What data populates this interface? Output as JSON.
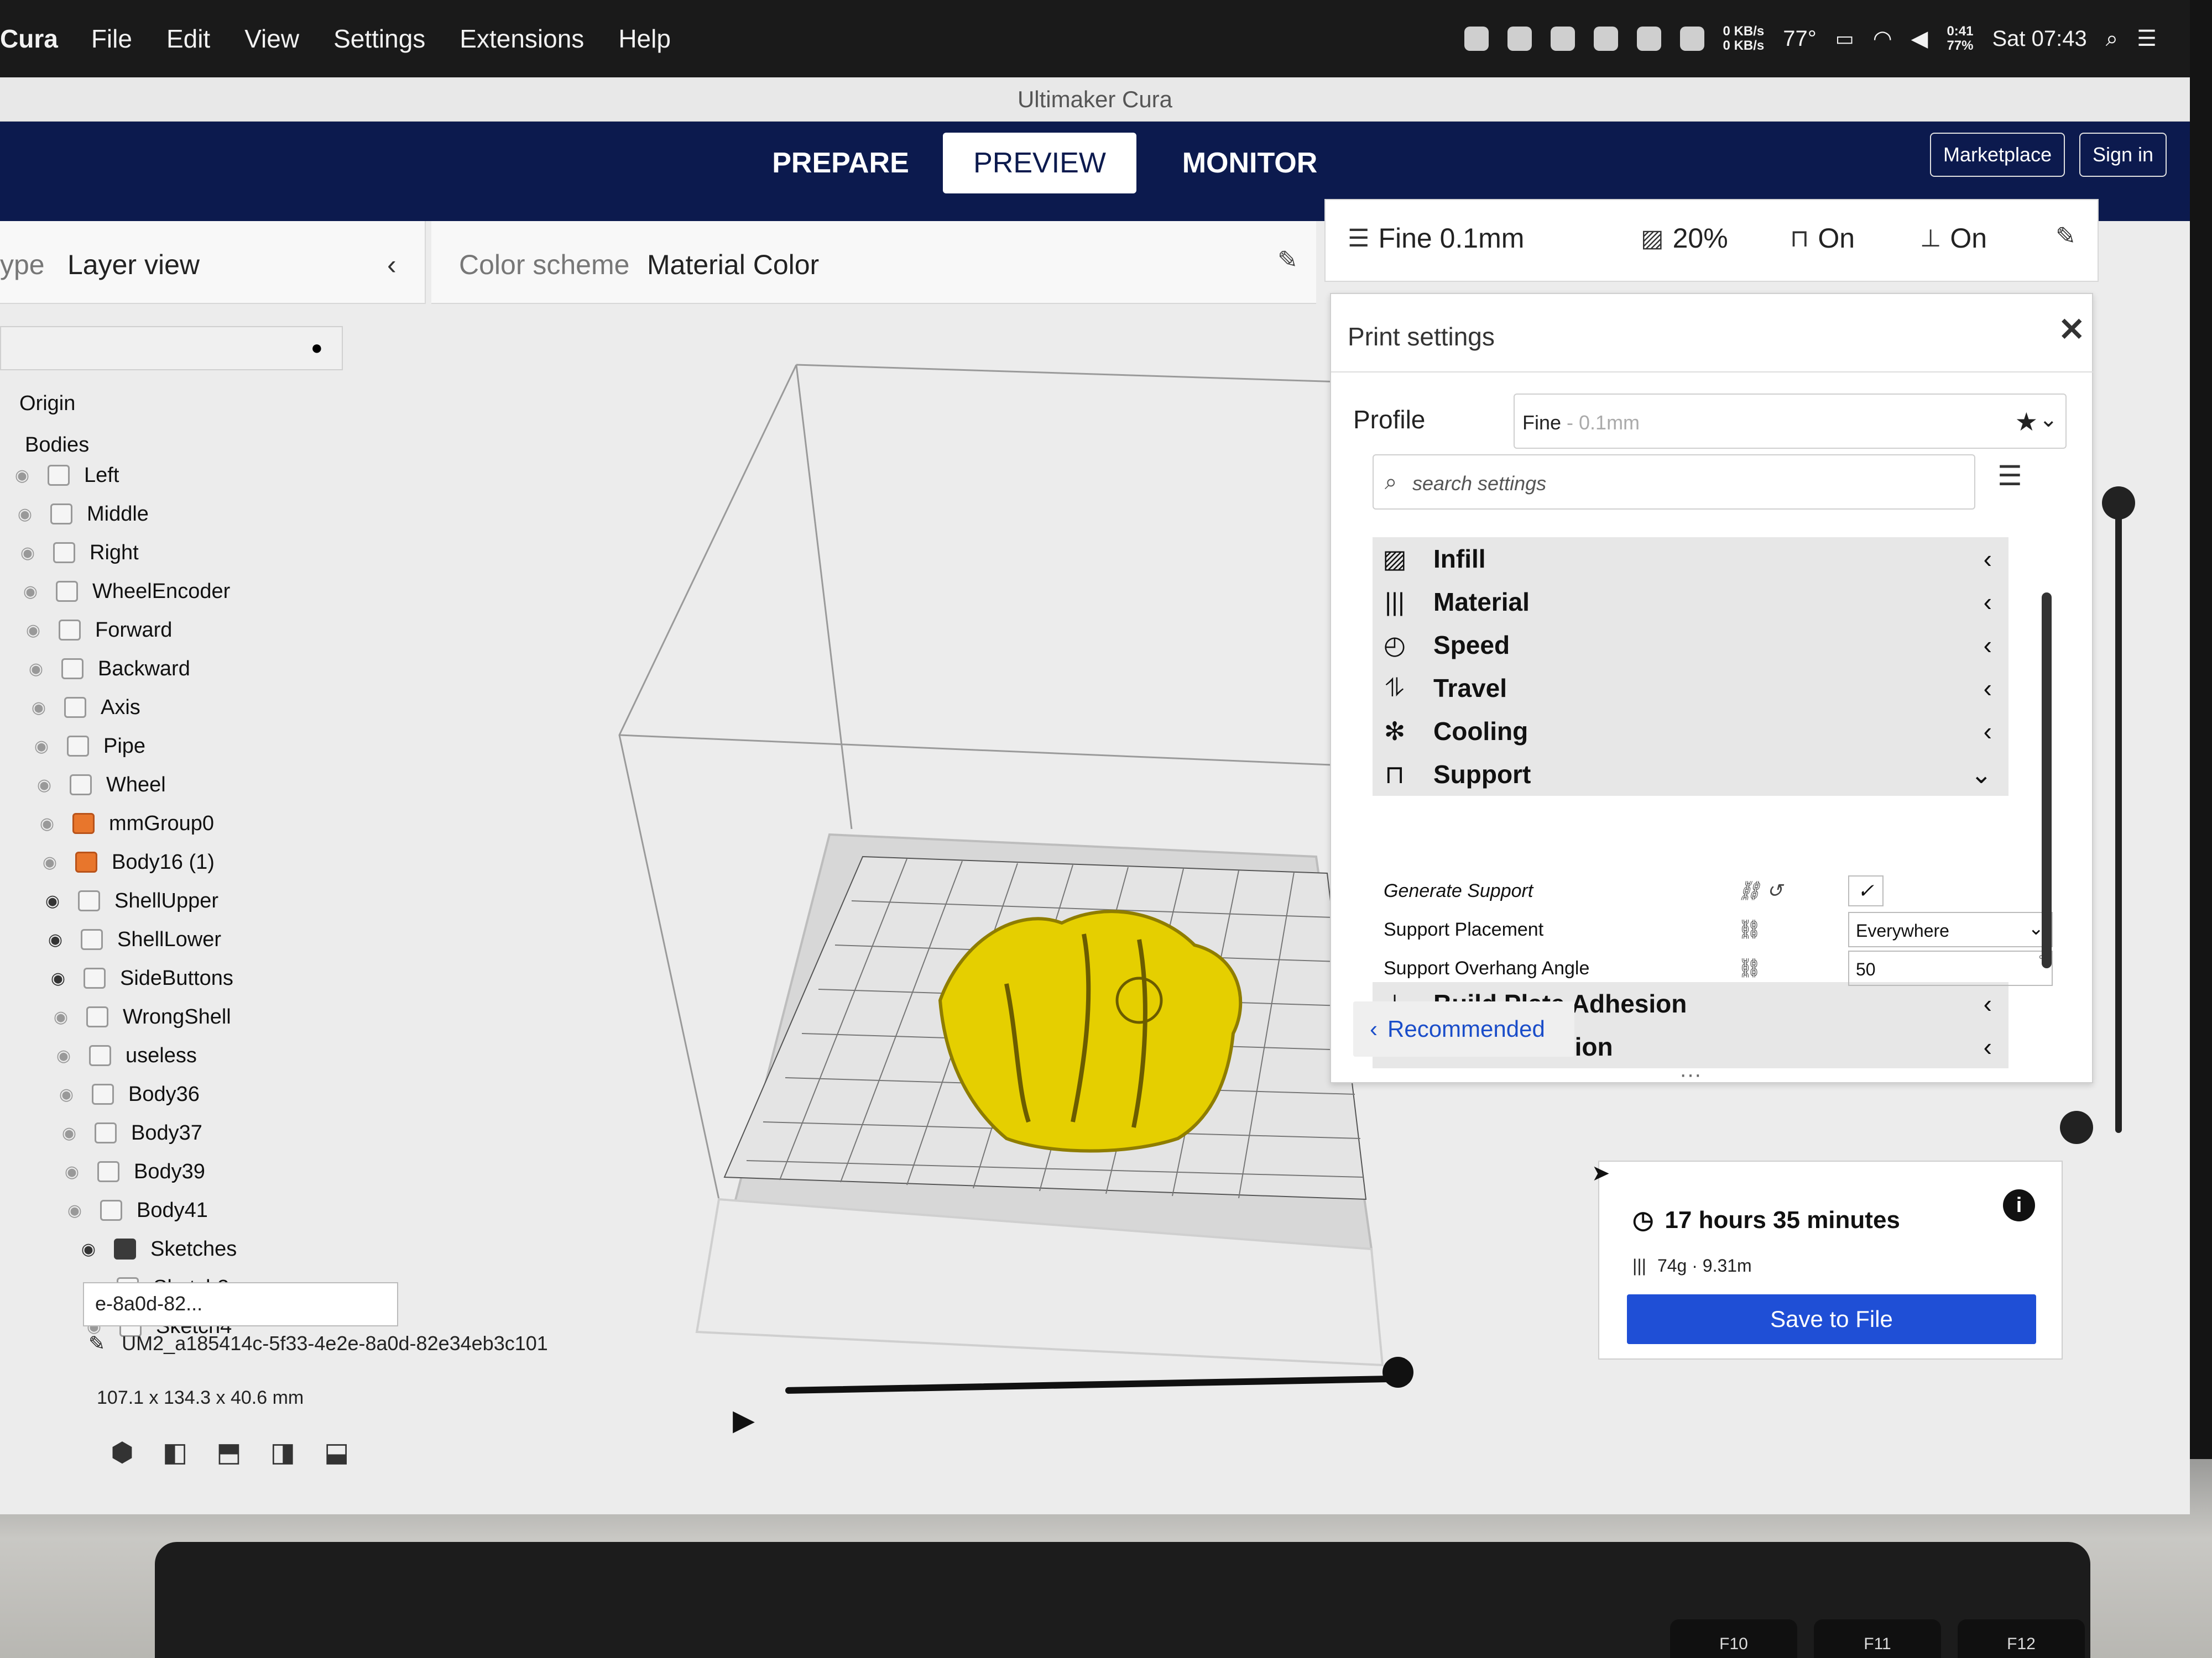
{
  "menubar": {
    "app": "Cura",
    "menus": [
      "File",
      "Edit",
      "View",
      "Settings",
      "Extensions",
      "Help"
    ],
    "net_up": "0 KB/s",
    "net_down": "0 KB/s",
    "temperature": "77°",
    "battery_time": "0:41",
    "battery_pct": "77%",
    "clock": "Sat 07:43"
  },
  "window": {
    "title": "Ultimaker Cura"
  },
  "header": {
    "stages": [
      "PREPARE",
      "PREVIEW",
      "MONITOR"
    ],
    "active_stage": "PREVIEW",
    "marketplace": "Marketplace",
    "sign_in": "Sign in"
  },
  "viewtype": {
    "label": "ype",
    "value": "Layer view"
  },
  "colorscheme": {
    "label": "Color scheme",
    "value": "Material Color"
  },
  "print_summary": {
    "profile": "Fine 0.1mm",
    "infill": "20%",
    "support": "On",
    "adhesion": "On"
  },
  "object_tree": {
    "items": [
      {
        "label": "Origin",
        "icon": "none"
      },
      {
        "label": "Bodies",
        "icon": "none"
      },
      {
        "label": "Left",
        "icon": "body"
      },
      {
        "label": "Middle",
        "icon": "body"
      },
      {
        "label": "Right",
        "icon": "body"
      },
      {
        "label": "WheelEncoder",
        "icon": "body"
      },
      {
        "label": "Forward",
        "icon": "body"
      },
      {
        "label": "Backward",
        "icon": "body"
      },
      {
        "label": "Axis",
        "icon": "body"
      },
      {
        "label": "Pipe",
        "icon": "body"
      },
      {
        "label": "Wheel",
        "icon": "body"
      },
      {
        "label": "mmGroup0",
        "icon": "group"
      },
      {
        "label": "Body16 (1)",
        "icon": "group"
      },
      {
        "label": "ShellUpper",
        "icon": "body",
        "visible": true
      },
      {
        "label": "ShellLower",
        "icon": "body",
        "visible": true
      },
      {
        "label": "SideButtons",
        "icon": "body",
        "visible": true
      },
      {
        "label": "WrongShell",
        "icon": "body"
      },
      {
        "label": "useless",
        "icon": "body"
      },
      {
        "label": "Body36",
        "icon": "body"
      },
      {
        "label": "Body37",
        "icon": "body"
      },
      {
        "label": "Body39",
        "icon": "body"
      },
      {
        "label": "Body41",
        "icon": "body"
      },
      {
        "label": "Sketches",
        "icon": "folder",
        "visible": true
      },
      {
        "label": "Sketch3",
        "icon": "sketch"
      },
      {
        "label": "Sketch4",
        "icon": "sketch"
      }
    ],
    "tooltip": "e-8a0d-82...",
    "object_name": "UM2_a185414c-5f33-4e2e-8a0d-82e34eb3c101",
    "dimensions": "107.1 x 134.3 x 40.6 mm"
  },
  "print_settings": {
    "title": "Print settings",
    "profile_label": "Profile",
    "profile_name": "Fine",
    "profile_sub": " - 0.1mm",
    "search_placeholder": "search settings",
    "categories": [
      {
        "label": "Infill",
        "icon": "infill-icon",
        "expanded": false
      },
      {
        "label": "Material",
        "icon": "material-icon",
        "expanded": false
      },
      {
        "label": "Speed",
        "icon": "speed-icon",
        "expanded": false
      },
      {
        "label": "Travel",
        "icon": "travel-icon",
        "expanded": false
      },
      {
        "label": "Cooling",
        "icon": "cooling-icon",
        "expanded": false
      },
      {
        "label": "Support",
        "icon": "support-icon",
        "expanded": true
      },
      {
        "label": "Build Plate Adhesion",
        "icon": "adhesion-icon",
        "expanded": false
      },
      {
        "label": "Dual Extrusion",
        "icon": "dual-extrusion-icon",
        "expanded": false
      }
    ],
    "support_settings": {
      "generate_support_label": "Generate Support",
      "generate_support_value": true,
      "placement_label": "Support Placement",
      "placement_value": "Everywhere",
      "overhang_label": "Support Overhang Angle",
      "overhang_value": "50",
      "overhang_unit": "°"
    },
    "recommended": "Recommended"
  },
  "output": {
    "print_time": "17 hours 35 minutes",
    "material": "74g · 9.31m",
    "save_button": "Save to File"
  },
  "colors": {
    "header_bg": "#0c1a4e",
    "accent_blue": "#1f4fd6",
    "model_yellow": "#e5cf00"
  },
  "keyboard": {
    "keys": [
      "F10",
      "F11",
      "F12"
    ]
  }
}
